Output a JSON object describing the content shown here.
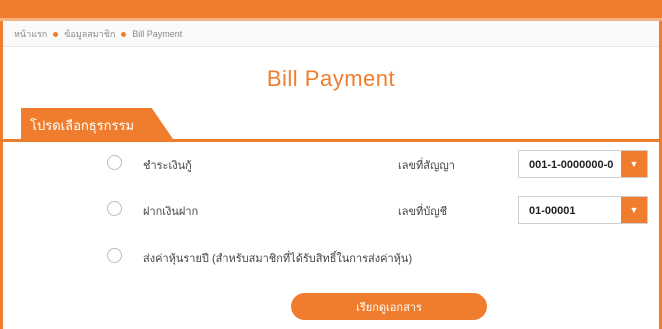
{
  "breadcrumb": {
    "items": [
      {
        "label": "หน้าแรก"
      },
      {
        "label": "ข้อมูลสมาชิก"
      },
      {
        "label": "Bill Payment"
      }
    ]
  },
  "page": {
    "title": "Bill Payment"
  },
  "section": {
    "title": "โปรดเลือกธุรกรรม"
  },
  "options": [
    {
      "label": "ชำระเงินกู้",
      "field_label": "เลขที่สัญญา",
      "select_value": "001-1-0000000-0"
    },
    {
      "label": "ฝากเงินฝาก",
      "field_label": "เลขที่บัญชี",
      "select_value": "01-00001"
    },
    {
      "label": "ส่งค่าหุ้นรายปี (สำหรับสมาชิกที่ได้รับสิทธิ์ในการส่งค่าหุ้น)"
    }
  ],
  "actions": {
    "submit_label": "เรียกดูเอกสาร"
  },
  "colors": {
    "accent": "#ef7d2d",
    "accent_light": "#f6b27f"
  },
  "icons": {
    "dropdown": "caret-down-icon",
    "breadcrumb_separator": "dot-icon"
  }
}
